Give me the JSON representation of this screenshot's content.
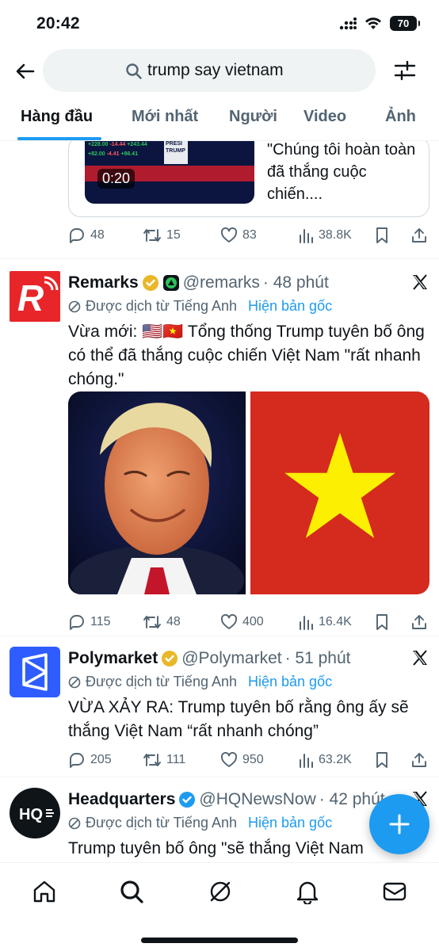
{
  "status_bar": {
    "time": "20:42",
    "battery": "70"
  },
  "search": {
    "value": "trump say vietnam"
  },
  "tabs": [
    {
      "label": "Hàng đầu",
      "active": true
    },
    {
      "label": "Mới nhất"
    },
    {
      "label": "Người"
    },
    {
      "label": "Video"
    },
    {
      "label": "Ảnh"
    }
  ],
  "previous_tweet": {
    "card_text": "\"Chúng tôi hoàn toàn đã thắng cuộc chiến....",
    "video_duration": "0:20",
    "thumb_numbers": [
      "+228.00",
      "-14.44",
      "+243.44",
      "+82.00",
      "-4.41",
      "+86.41"
    ],
    "thumb_text": "PRESI TRUMP",
    "replies": "48",
    "retweets": "15",
    "likes": "83",
    "views": "38.8K"
  },
  "tweets": [
    {
      "name": "Remarks",
      "handle": "@remarks",
      "time": "· 48 phút",
      "translated": "Được dịch từ Tiếng Anh",
      "show_original": "Hiện bản gốc",
      "text": "Vừa mới: 🇺🇸🇻🇳 Tổng thống Trump tuyên bố ông có thể đã thắng cuộc chiến Việt Nam \"rất nhanh chóng.\"",
      "replies": "115",
      "retweets": "48",
      "likes": "400",
      "views": "16.4K"
    },
    {
      "name": "Polymarket",
      "handle": "@Polymarket",
      "time": "· 51 phút",
      "translated": "Được dịch từ Tiếng Anh",
      "show_original": "Hiện bản gốc",
      "text": "VỪA XẢY RA: Trump tuyên bố rằng ông ấy sẽ thắng Việt Nam “rất nhanh chóng”",
      "replies": "205",
      "retweets": "111",
      "likes": "950",
      "views": "63.2K"
    },
    {
      "name": "Headquarters",
      "handle": "@HQNewsNow",
      "time": "· 42 phút",
      "translated": "Được dịch từ Tiếng Anh",
      "show_original": "Hiện bản gốc",
      "text": "Trump tuyên bố ông \"sẽ thắng Việt Nam rất nhanh\" nếu ông còn Tổng thống..."
    }
  ],
  "icons": {
    "verified": "verified-badge-icon",
    "x_logo": "x-logo-icon",
    "compose": "plus-icon"
  },
  "colors": {
    "accent": "#1d9bf0",
    "verified": "#e8b829",
    "text": "#0f1419",
    "muted": "#536471"
  }
}
